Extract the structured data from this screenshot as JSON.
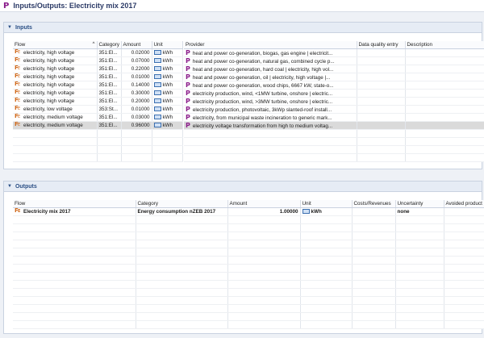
{
  "app": {
    "title": "Inputs/Outputs: Electricity mix 2017"
  },
  "inputs": {
    "section_label": "Inputs",
    "left_columns": [
      "Flow",
      "Category",
      "Amount",
      "Unit"
    ],
    "right_columns": [
      "Provider",
      "Data quality entry",
      "Description"
    ],
    "sort_indicator": "^",
    "rows": [
      {
        "flow": "electricity, high voltage",
        "category": "351:El...",
        "amount": "0.02000",
        "unit": "kWh",
        "provider": "heat and power co-generation, biogas, gas engine | electricit..."
      },
      {
        "flow": "electricity, high voltage",
        "category": "351:El...",
        "amount": "0.07000",
        "unit": "kWh",
        "provider": "heat and power co-generation, natural gas, combined cycle p..."
      },
      {
        "flow": "electricity, high voltage",
        "category": "351:El...",
        "amount": "0.22000",
        "unit": "kWh",
        "provider": "heat and power co-generation, hard coal | electricity, high vol..."
      },
      {
        "flow": "electricity, high voltage",
        "category": "351:El...",
        "amount": "0.01000",
        "unit": "kWh",
        "provider": "heat and power co-generation, oil | electricity, high voltage |..."
      },
      {
        "flow": "electricity, high voltage",
        "category": "351:El...",
        "amount": "0.14000",
        "unit": "kWh",
        "provider": "heat and power co-generation, wood chips, 6667 kW, state-o..."
      },
      {
        "flow": "electricity, high voltage",
        "category": "351:El...",
        "amount": "0.30000",
        "unit": "kWh",
        "provider": "electricity production, wind, <1MW turbine, onshore | electric..."
      },
      {
        "flow": "electricity, high voltage",
        "category": "351:El...",
        "amount": "0.20000",
        "unit": "kWh",
        "provider": "electricity production, wind, >3MW turbine, onshore | electric..."
      },
      {
        "flow": "electricity, low voltage",
        "category": "353:St...",
        "amount": "0.01000",
        "unit": "kWh",
        "provider": "electricity production, photovoltaic, 3kWp slanted-roof install..."
      },
      {
        "flow": "electricity, medium voltage",
        "category": "351:El...",
        "amount": "0.03000",
        "unit": "kWh",
        "provider": "electricity, from municipal waste incineration to generic mark..."
      },
      {
        "flow": "electricity, medium voltage",
        "category": "351:El...",
        "amount": "0.96000",
        "unit": "kWh",
        "provider": "electricity voltage transformation from high to medium voltag...",
        "selected": true
      }
    ]
  },
  "outputs": {
    "section_label": "Outputs",
    "columns": [
      "Flow",
      "Category",
      "Amount",
      "Unit",
      "Costs/Revenues",
      "Uncertainty",
      "Avoided product"
    ],
    "rows": [
      {
        "flow": "Electricity mix 2017",
        "category": "Energy consumption nZEB 2017",
        "amount": "1.00000",
        "unit": "kWh",
        "costs": "",
        "uncertainty": "none",
        "avoided": ""
      }
    ]
  },
  "icons": {
    "flow": "flow-elementary-icon",
    "unit": "unit-icon",
    "provider": "process-icon",
    "collapse": "chevron-down-icon",
    "logo": "openlca-process-icon"
  },
  "colors": {
    "accent": "#2b4f85",
    "process": "#8a1c8a",
    "flow": "#d06a1c",
    "selected_row": "#dadada"
  }
}
